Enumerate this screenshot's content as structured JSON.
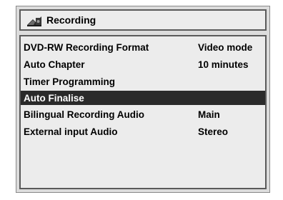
{
  "header": {
    "title": "Recording",
    "icon": "recording-icon"
  },
  "menu": {
    "items": [
      {
        "label": "DVD-RW Recording Format",
        "value": "Video mode",
        "selected": false
      },
      {
        "label": "Auto Chapter",
        "value": "10 minutes",
        "selected": false
      },
      {
        "label": "Timer Programming",
        "value": "",
        "selected": false
      },
      {
        "label": "Auto Finalise",
        "value": "",
        "selected": true
      },
      {
        "label": "Bilingual Recording Audio",
        "value": "Main",
        "selected": false
      },
      {
        "label": "External input Audio",
        "value": "Stereo",
        "selected": false
      }
    ]
  },
  "colors": {
    "highlight": "#2a2a2a",
    "panel": "#ececec",
    "frame": "#dcdcdc"
  }
}
